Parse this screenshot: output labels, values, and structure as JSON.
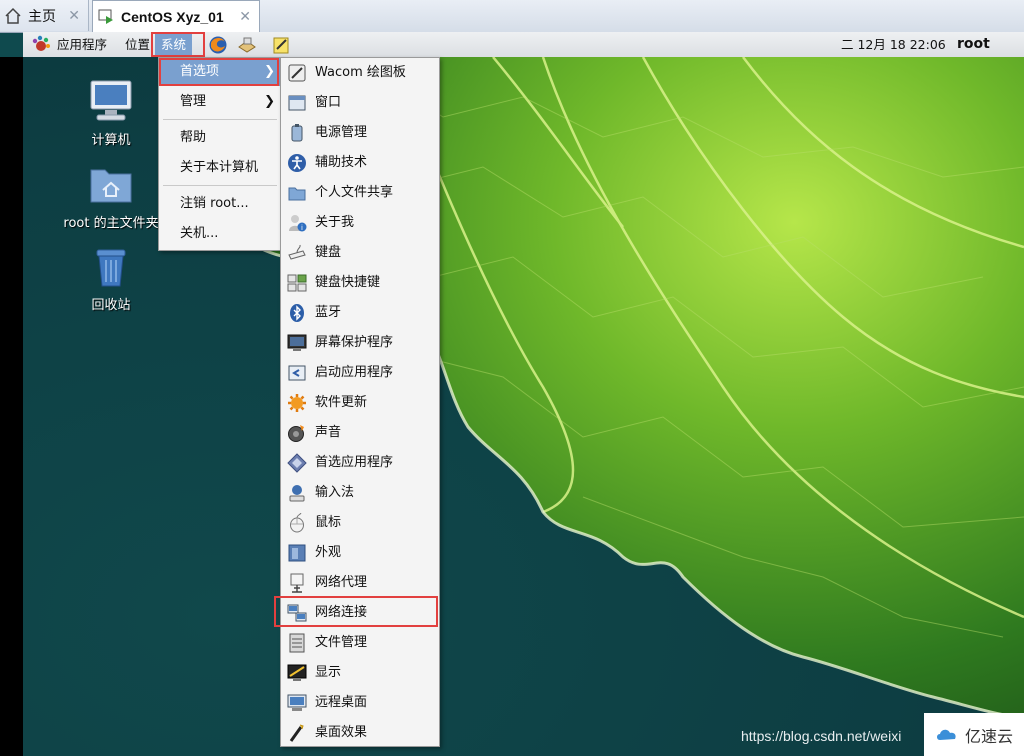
{
  "tabs": [
    {
      "label": "主页",
      "icon": "home-icon"
    },
    {
      "label": "CentOS Xyz_01",
      "icon": "vm-icon"
    }
  ],
  "panel": {
    "apps_label": "应用程序",
    "places_label": "位置",
    "system_label": "系统",
    "clock": "二 12月 18 22:06",
    "user": "root"
  },
  "desktop_icons": [
    {
      "label": "计算机",
      "icon": "computer-icon"
    },
    {
      "label": "root 的主文件夹",
      "icon": "home-folder-icon"
    },
    {
      "label": "回收站",
      "icon": "trash-icon"
    }
  ],
  "system_menu": {
    "items": [
      {
        "label": "首选项",
        "has_submenu": true
      },
      {
        "label": "管理",
        "has_submenu": true
      },
      {
        "label": "帮助"
      },
      {
        "label": "关于本计算机"
      },
      {
        "label": "注销 root..."
      },
      {
        "label": "关机..."
      }
    ]
  },
  "preferences_submenu": {
    "items": [
      {
        "label": "Wacom 绘图板",
        "icon": "wacom-tablet-icon"
      },
      {
        "label": "窗口",
        "icon": "window-icon"
      },
      {
        "label": "电源管理",
        "icon": "power-icon"
      },
      {
        "label": "辅助技术",
        "icon": "accessibility-icon"
      },
      {
        "label": "个人文件共享",
        "icon": "file-share-icon"
      },
      {
        "label": "关于我",
        "icon": "about-me-icon"
      },
      {
        "label": "键盘",
        "icon": "keyboard-icon"
      },
      {
        "label": "键盘快捷键",
        "icon": "keyboard-shortcuts-icon"
      },
      {
        "label": "蓝牙",
        "icon": "bluetooth-icon"
      },
      {
        "label": "屏幕保护程序",
        "icon": "screensaver-icon"
      },
      {
        "label": "启动应用程序",
        "icon": "startup-apps-icon"
      },
      {
        "label": "软件更新",
        "icon": "software-update-icon"
      },
      {
        "label": "声音",
        "icon": "sound-icon"
      },
      {
        "label": "首选应用程序",
        "icon": "preferred-apps-icon"
      },
      {
        "label": "输入法",
        "icon": "input-method-icon"
      },
      {
        "label": "鼠标",
        "icon": "mouse-icon"
      },
      {
        "label": "外观",
        "icon": "appearance-icon"
      },
      {
        "label": "网络代理",
        "icon": "network-proxy-icon"
      },
      {
        "label": "网络连接",
        "icon": "network-connections-icon"
      },
      {
        "label": "文件管理",
        "icon": "file-management-icon"
      },
      {
        "label": "显示",
        "icon": "display-icon"
      },
      {
        "label": "远程桌面",
        "icon": "remote-desktop-icon"
      },
      {
        "label": "桌面效果",
        "icon": "desktop-effects-icon"
      }
    ]
  },
  "watermark": {
    "url_text": "https://blog.csdn.net/weixi",
    "brand": "亿速云"
  },
  "colors": {
    "highlight_box": "#e2403f",
    "menu_selection": "#7aa0cf"
  }
}
